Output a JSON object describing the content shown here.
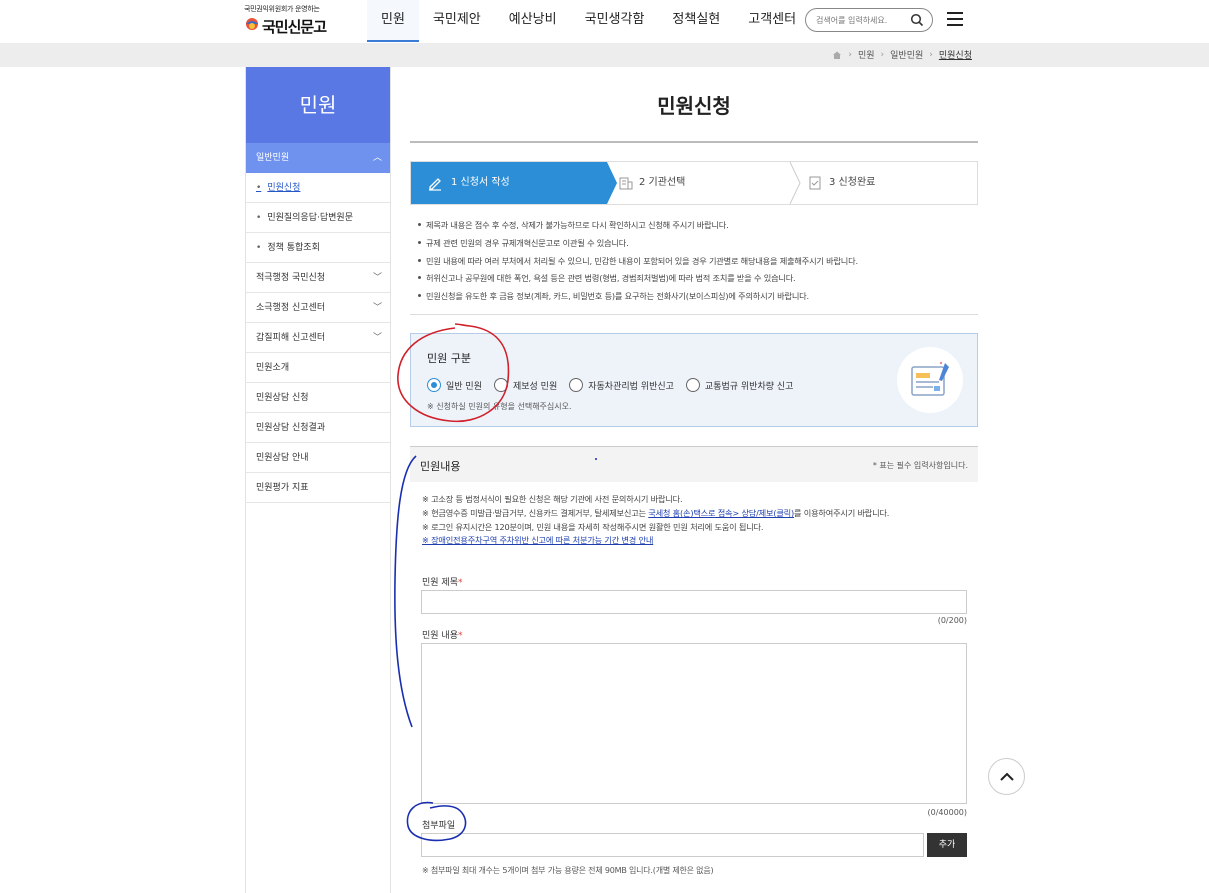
{
  "header": {
    "logo_sub": "국민권익위원회가 운영하는",
    "logo_main": "국민신문고",
    "nav": [
      "민원",
      "국민제안",
      "예산낭비",
      "국민생각함",
      "정책실현",
      "고객센터"
    ],
    "search_placeholder": "검색어를 입력하세요."
  },
  "breadcrumb": [
    "민원",
    "일반민원",
    "민원신청"
  ],
  "sidebar": {
    "title": "민원",
    "open_group": "일반민원",
    "sub_items": [
      "민원신청",
      "민원질의응답·답변원문",
      "정책 통합조회"
    ],
    "items": [
      {
        "label": "적극행정 국민신청",
        "expandable": true
      },
      {
        "label": "소극행정 신고센터",
        "expandable": true
      },
      {
        "label": "갑질피해 신고센터",
        "expandable": true
      },
      {
        "label": "민원소개",
        "expandable": false
      },
      {
        "label": "민원상담 신청",
        "expandable": false
      },
      {
        "label": "민원상담 신청결과",
        "expandable": false
      },
      {
        "label": "민원상담 안내",
        "expandable": false
      },
      {
        "label": "민원평가 지표",
        "expandable": false
      }
    ]
  },
  "page_title": "민원신청",
  "steps": [
    "1 신청서 작성",
    "2 기관선택",
    "3 신청완료"
  ],
  "notices": [
    "제목과 내용은 접수 후 수정, 삭제가 불가능하므로 다시 확인하시고 신청해 주시기 바랍니다.",
    "규제 관련 민원의 경우 규제개혁신문고로 이관될 수 있습니다.",
    "민원 내용에 따라 여러 부처에서 처리될 수 있으니, 민감한 내용이 포함되어 있을 경우 기관별로 해당내용을 제출해주시기 바랍니다.",
    "허위신고나 공무원에 대한 폭언, 욕설 등은 관련 법령(형법, 경범죄처벌법)에 따라 법적 조치를 받을 수 있습니다.",
    "민원신청을 유도한 후 금융 정보(계좌, 카드, 비밀번호 등)를 요구하는 전화사기(보이스피싱)에 주의하시기 바랍니다."
  ],
  "complaint_type": {
    "title": "민원 구분",
    "options": [
      "일반 민원",
      "제보성 민원",
      "자동차관리법 위반신고",
      "교통법규 위반차량 신고"
    ],
    "selected": "일반 민원",
    "hint": "※ 신청하실 민원의 유형을 선택해주십시오."
  },
  "content_section": {
    "title": "민원내용",
    "required_note": "* 표는 필수 입력사항입니다.",
    "guide_1": "※ 고소장 등 법정서식이 필요한 신청은 해당 기관에 사전 문의하시기 바랍니다.",
    "guide_2_pre": "※ 현금영수증 미발급·발급거부, 신용카드 결제거부, 탈세제보신고는 ",
    "guide_2_link": "국세청 홈(손)택스로 접속> 상담/제보(클릭)",
    "guide_2_post": "를 이용하여주시기 바랍니다.",
    "guide_3": "※ 로그인 유지시간은 120분이며, 민원 내용을 자세히 작성해주시면 원활한 민원 처리에 도움이 됩니다.",
    "guide_4_link": "※ 장애인전용주차구역 주차위반 신고에 따른 처분가능 기간 변경 안내",
    "title_label": "민원 제목",
    "title_value": "",
    "title_counter": "(0/200)",
    "body_label": "민원 내용",
    "body_value": "",
    "body_counter": "(0/40000)",
    "file_label": "첨부파일",
    "file_value": "",
    "add_button": "추가",
    "file_note": "※ 첨부파일 최대 개수는 5개이며 첨부 가능 용량은 전체 90MB 입니다.(개별 제한은 없음)"
  },
  "colors": {
    "sidebar_title_bg": "#5a78e4",
    "sidebar_open_bg": "#6f92ee",
    "step_active_bg": "#2c8ed6",
    "annotation_red": "#d0202a",
    "annotation_blue": "#1a2fb0"
  }
}
